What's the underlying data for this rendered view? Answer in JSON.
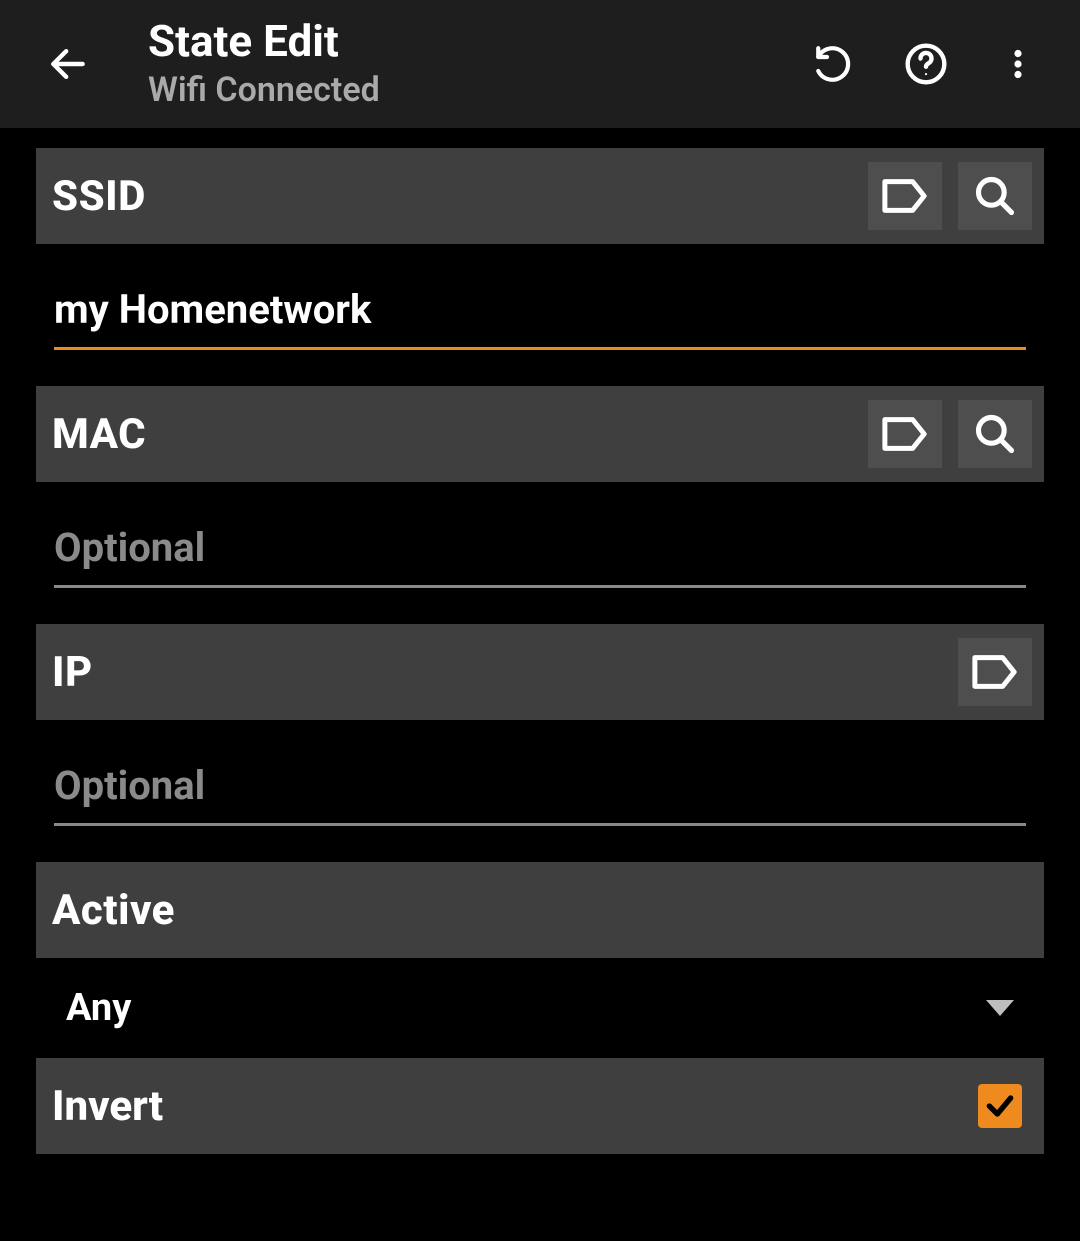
{
  "header": {
    "title": "State Edit",
    "subtitle": "Wifi Connected"
  },
  "sections": {
    "ssid": {
      "label": "SSID",
      "value": "my Homenetwork",
      "placeholder": ""
    },
    "mac": {
      "label": "MAC",
      "value": "",
      "placeholder": "Optional"
    },
    "ip": {
      "label": "IP",
      "value": "",
      "placeholder": "Optional"
    },
    "active": {
      "label": "Active",
      "value": "Any"
    },
    "invert": {
      "label": "Invert",
      "checked": true
    }
  },
  "colors": {
    "accent": "#ef8a1e",
    "panel": "#3f3f3f",
    "bg": "#000000"
  }
}
